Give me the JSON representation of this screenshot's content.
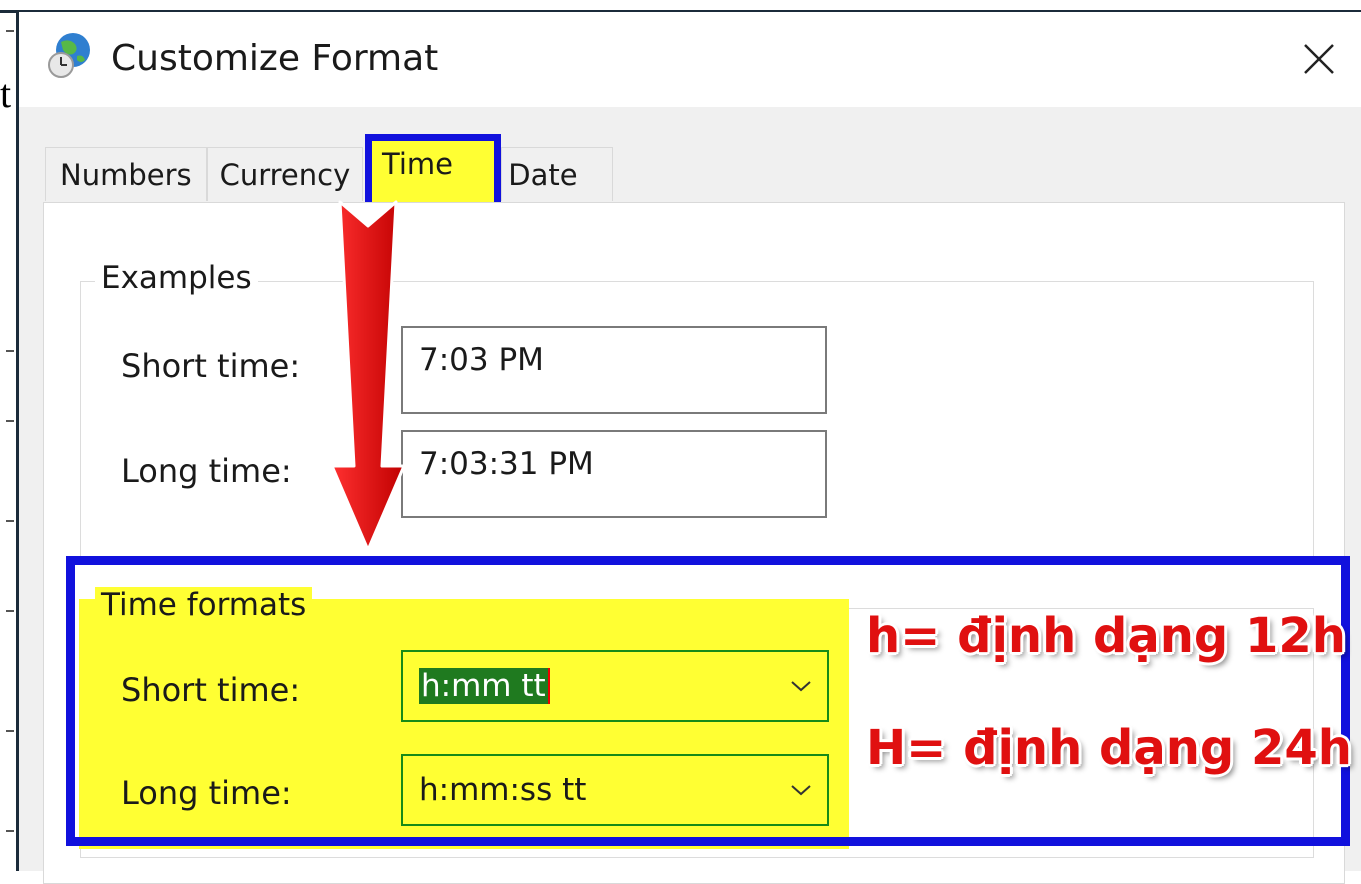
{
  "background": {
    "fragment": "t"
  },
  "dialog": {
    "title": "Customize Format",
    "icons": {
      "app": "globe-clock-icon",
      "close": "close-icon"
    }
  },
  "tabs": [
    {
      "label": "Numbers",
      "selected": false
    },
    {
      "label": "Currency",
      "selected": false
    },
    {
      "label": "Time",
      "selected": true
    },
    {
      "label": "Date",
      "selected": false
    }
  ],
  "examples": {
    "heading": "Examples",
    "short_label": "Short time:",
    "short_value": "7:03 PM",
    "long_label": "Long time:",
    "long_value": "7:03:31 PM"
  },
  "time_formats": {
    "heading": "Time formats",
    "short_label": "Short time:",
    "short_value": "h:mm tt",
    "long_label": "Long time:",
    "long_value": "h:mm:ss tt"
  },
  "annotations": {
    "line1": "h= định dạng 12h",
    "line2": "H= định dạng 24h"
  },
  "colors": {
    "highlight": "#ffff33",
    "annotation_frame": "#1111dd",
    "annotation_text": "#e01010",
    "arrow": "#e00000"
  }
}
